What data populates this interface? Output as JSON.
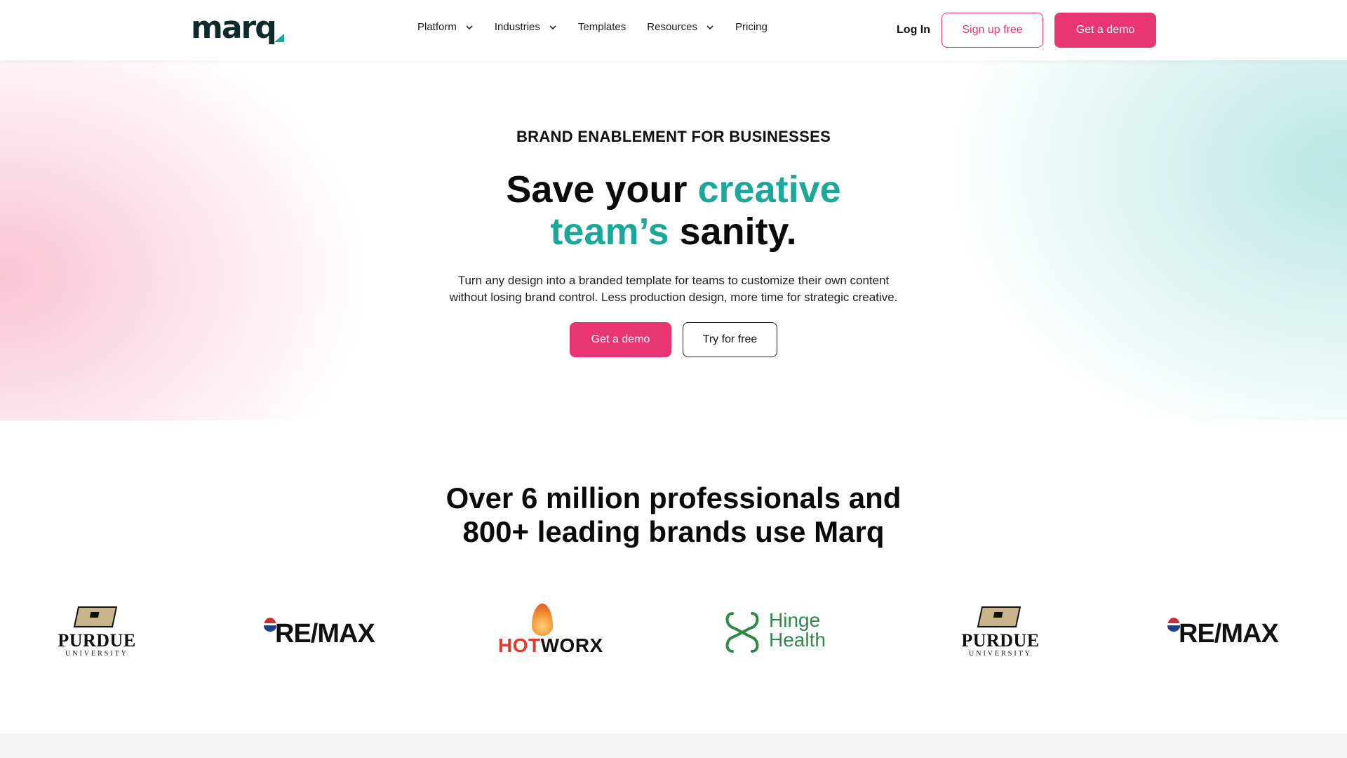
{
  "header": {
    "logo_text": "marq",
    "nav": [
      {
        "label": "Platform",
        "has_dropdown": true
      },
      {
        "label": "Industries",
        "has_dropdown": true
      },
      {
        "label": "Templates",
        "has_dropdown": false
      },
      {
        "label": "Resources",
        "has_dropdown": true
      },
      {
        "label": "Pricing",
        "has_dropdown": false
      }
    ],
    "login_label": "Log In",
    "signup_label": "Sign up free",
    "demo_label": "Get a demo"
  },
  "hero": {
    "eyebrow": "BRAND ENABLEMENT FOR BUSINESSES",
    "headline_part1": "Save your ",
    "headline_teal1": "creative",
    "headline_teal2": "team’s",
    "headline_part2": " sanity.",
    "subtext_line1": "Turn any design into a branded template for teams to customize their own content",
    "subtext_line2": "without losing brand control. Less production design, more time for strategic creative.",
    "primary_cta": "Get a demo",
    "secondary_cta": "Try for free"
  },
  "proof": {
    "title_line1": "Over 6 million professionals and",
    "title_line2": "800+ leading brands use Marq",
    "logos": [
      {
        "brand": "purdue",
        "name": "PURDUE",
        "sub": "UNIVERSITY"
      },
      {
        "brand": "remax",
        "name": "RE/MAX"
      },
      {
        "brand": "hotworx",
        "hot": "HOT",
        "worx": "WORX"
      },
      {
        "brand": "hinge",
        "line1": "Hinge",
        "line2": "Health"
      },
      {
        "brand": "purdue",
        "name": "PURDUE",
        "sub": "UNIVERSITY"
      },
      {
        "brand": "remax",
        "name": "RE/MAX"
      }
    ]
  },
  "colors": {
    "accent_pink": "#ea3573",
    "accent_teal": "#1aa89b",
    "logo_dark": "#0f2a2a"
  },
  "icons": {
    "dropdown": "chevron-down-icon"
  }
}
